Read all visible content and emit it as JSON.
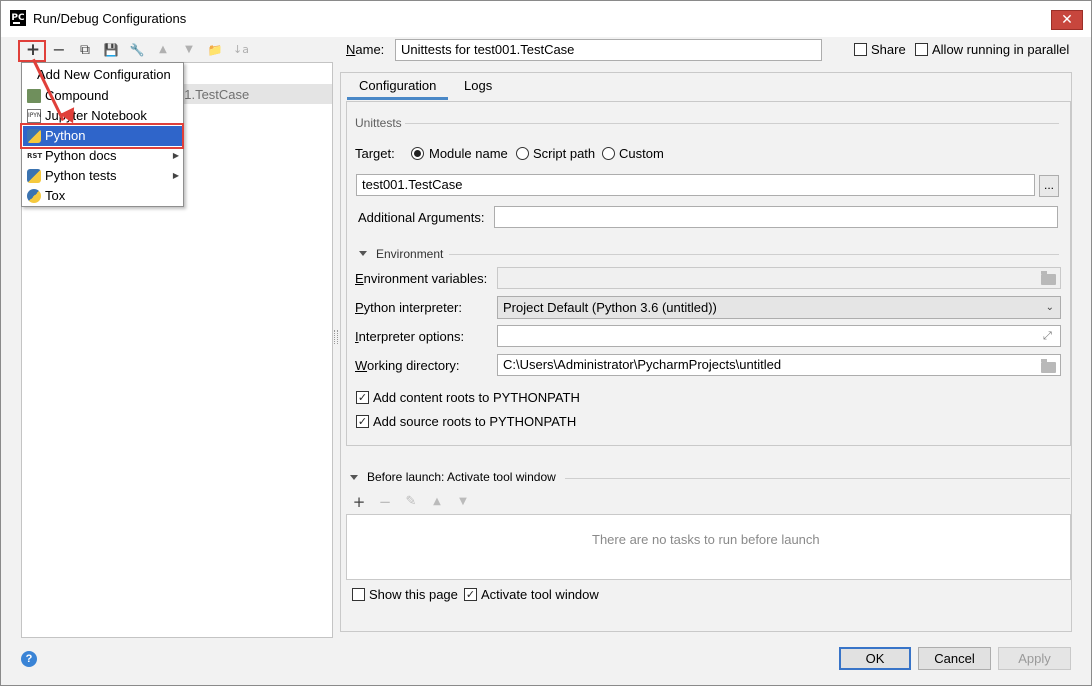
{
  "window": {
    "title": "Run/Debug Configurations",
    "close_label": "✕",
    "app_icon_text": "PC"
  },
  "toolbar": {
    "add": "+",
    "remove": "−",
    "copy": "⧉",
    "save": "💾",
    "edit_defaults": "🔧",
    "move_up": "▲",
    "move_down": "▼",
    "folder": "📁",
    "sort": "↓a"
  },
  "tree": {
    "selected_item_fragment": "01.TestCase"
  },
  "popup": {
    "header": "Add New Configuration",
    "items": [
      {
        "label": "Compound",
        "icon": "compound-icon",
        "has_submenu": false
      },
      {
        "label": "Jupyter Notebook",
        "icon": "jupyter-icon",
        "has_submenu": false
      },
      {
        "label": "Python",
        "icon": "python-icon",
        "has_submenu": false,
        "selected": true
      },
      {
        "label": "Python docs",
        "icon": "rst-icon",
        "has_submenu": true
      },
      {
        "label": "Python tests",
        "icon": "python-tests-icon",
        "has_submenu": true
      },
      {
        "label": "Tox",
        "icon": "tox-icon",
        "has_submenu": false
      }
    ],
    "submenu_arrow": "▶",
    "jupyter_icon_text": "IPYN",
    "rst_icon_text": "RST"
  },
  "header": {
    "name_label": "Name:",
    "name_value": "Unittests for test001.TestCase",
    "share_label": "Share",
    "share_checked": false,
    "parallel_label": "Allow running in parallel",
    "parallel_checked": false
  },
  "tabs": [
    {
      "label": "Configuration",
      "active": true
    },
    {
      "label": "Logs",
      "active": false
    }
  ],
  "config": {
    "group_title": "Unittests",
    "target_label": "Target:",
    "target_options": [
      {
        "label": "Module name",
        "selected": true
      },
      {
        "label": "Script path",
        "selected": false
      },
      {
        "label": "Custom",
        "selected": false
      }
    ],
    "target_value": "test001.TestCase",
    "browse_label": "...",
    "additional_args_label": "Additional Arguments:",
    "additional_args_value": "",
    "environment_section": "Environment",
    "env_vars_label": "Environment variables:",
    "env_vars_value": "",
    "interpreter_label": "Python interpreter:",
    "interpreter_value": "Project Default (Python 3.6 (untitled))",
    "interpreter_options_label": "Interpreter options:",
    "interpreter_options_value": "",
    "working_dir_label": "Working directory:",
    "working_dir_value": "C:\\Users\\Administrator\\PycharmProjects\\untitled",
    "content_roots_label": "Add content roots to PYTHONPATH",
    "content_roots_checked": true,
    "source_roots_label": "Add source roots to PYTHONPATH",
    "source_roots_checked": true,
    "check_mark": "✓",
    "dropdown_arrow": "⌄",
    "expand_glyph": "⤢"
  },
  "before_launch": {
    "title": "Before launch: Activate tool window",
    "add": "+",
    "remove": "−",
    "edit": "✎",
    "up": "▲",
    "down": "▼",
    "empty_text": "There are no tasks to run before launch",
    "show_page_label": "Show this page",
    "show_page_checked": false,
    "activate_label": "Activate tool window",
    "activate_checked": true
  },
  "footer": {
    "help": "?",
    "ok": "OK",
    "cancel": "Cancel",
    "apply": "Apply"
  },
  "colors": {
    "selection": "#2f65ca",
    "annotation": "#e0403a",
    "tab_accent": "#4a88c7"
  }
}
